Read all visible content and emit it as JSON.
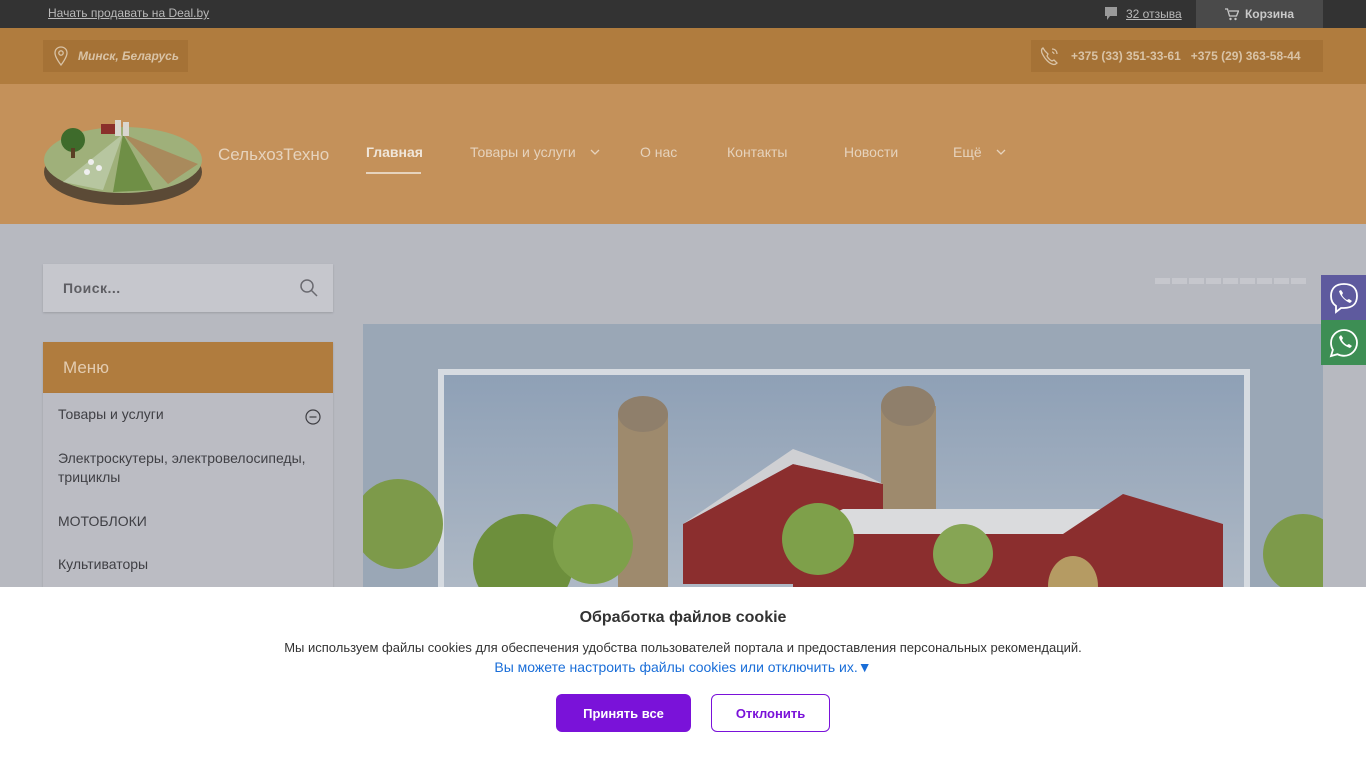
{
  "topbar": {
    "sell_link": "Начать продавать на Deal.by",
    "reviews": "32 отзыва",
    "cart": "Корзина",
    "chat_icon": "chat-bubble-icon",
    "cart_icon": "cart-icon"
  },
  "contacts": {
    "location": "Минск, Беларусь",
    "phone1": "+375 (33) 351-33-61",
    "phone2": "+375 (29) 363-58-44"
  },
  "header": {
    "brand": "СельхозТехно",
    "nav": [
      {
        "label": "Главная",
        "active": true
      },
      {
        "label": "Товары и услуги",
        "dropdown": true
      },
      {
        "label": "О нас"
      },
      {
        "label": "Контакты"
      },
      {
        "label": "Новости"
      },
      {
        "label": "Ещё",
        "dropdown": true
      }
    ]
  },
  "sidebar": {
    "search_placeholder": "Поиск...",
    "menu_title": "Меню",
    "items": [
      "Товары и услуги",
      "Электроскутеры, электровелосипеды, трициклы",
      "МОТОБЛОКИ",
      "Культиваторы"
    ]
  },
  "slider": {
    "dot_count": 9
  },
  "messengers": [
    "viber-icon",
    "whatsapp-icon"
  ],
  "cookie": {
    "title": "Обработка файлов cookie",
    "text": "Мы используем файлы cookies для обеспечения удобства пользователей портала и предоставления персональных рекомендаций.",
    "link": "Вы можете настроить файлы cookies или отключить их.▼",
    "accept": "Принять все",
    "decline": "Отклонить"
  },
  "colors": {
    "accent": "#7a12d9",
    "orange": "#b07c3e",
    "link": "#1a6ed8"
  }
}
